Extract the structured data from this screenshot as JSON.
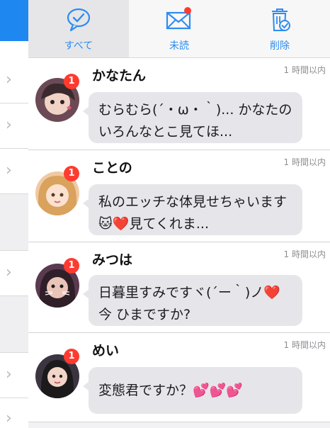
{
  "tabs": [
    {
      "label": "すべて",
      "icon": "chat-bubble-check-icon",
      "active": true
    },
    {
      "label": "未読",
      "icon": "envelope-icon",
      "has_notification_dot": true
    },
    {
      "label": "削除",
      "icon": "trash-check-icon"
    }
  ],
  "messages": [
    {
      "name": "かなたん",
      "time": "1 時間以内",
      "badge": "1",
      "text": "むらむら(´・ω・｀)... かなたのいろんなとこ見てほ..."
    },
    {
      "name": "ことの",
      "time": "1 時間以内",
      "badge": "1",
      "text": "私のエッチな体見せちゃいます🐱❤️見てくれま..."
    },
    {
      "name": "みつは",
      "time": "1 時間以内",
      "badge": "1",
      "text": "日暮里すみですヾ(´ー｀)ノ❤️ 今 ひまですか?"
    },
    {
      "name": "めい",
      "time": "1 時間以内",
      "badge": "1",
      "text": "変態君ですか？💕💕💕"
    }
  ],
  "colors": {
    "accent": "#2d8cf0",
    "badge": "#ff3b30",
    "bubble": "#e6e6ea",
    "left_blue": "#1f87f0"
  },
  "left_list": {
    "chevron_icon": "chevron-right-icon"
  }
}
